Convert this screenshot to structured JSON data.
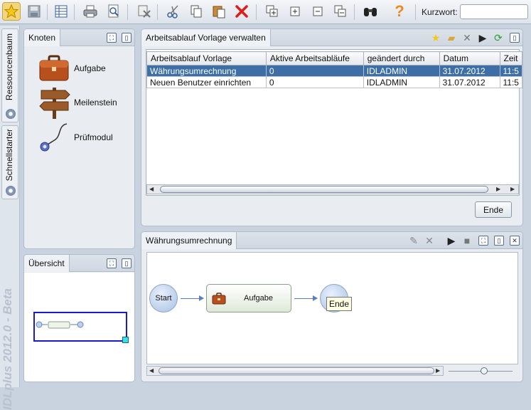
{
  "toolbar": {
    "search_label": "Kurzwort:",
    "search_value": ""
  },
  "sidebar": {
    "tabs": [
      {
        "label": "Ressourcenbaum"
      },
      {
        "label": "Schnellstarter"
      }
    ],
    "watermark": "IDLplus 2012.0 - Beta"
  },
  "knoten": {
    "title": "Knoten",
    "items": [
      {
        "label": "Aufgabe",
        "icon": "briefcase-icon"
      },
      {
        "label": "Meilenstein",
        "icon": "signpost-icon"
      },
      {
        "label": "Prüfmodul",
        "icon": "stethoscope-icon"
      }
    ]
  },
  "uebersicht": {
    "title": "Übersicht"
  },
  "workflows": {
    "title": "Arbeitsablauf Vorlage verwalten",
    "columns": [
      "Arbeitsablauf Vorlage",
      "Aktive Arbeitsabläufe",
      "geändert durch",
      "Datum",
      "Zeit"
    ],
    "rows": [
      {
        "vorlage": "Währungsumrechnung",
        "aktive": "0",
        "geaendert": "IDLADMIN",
        "datum": "31.07.2012",
        "zeit": "11:5",
        "selected": true
      },
      {
        "vorlage": "Neuen Benutzer einrichten",
        "aktive": "0",
        "geaendert": "IDLADMIN",
        "datum": "31.07.2012",
        "zeit": "11:5",
        "selected": false
      }
    ],
    "close_button": "Ende"
  },
  "diagram": {
    "title": "Währungsumrechnung",
    "start_label": "Start",
    "task_label": "Aufgabe",
    "tooltip": "Ende",
    "accent": "#3d6ea5"
  }
}
